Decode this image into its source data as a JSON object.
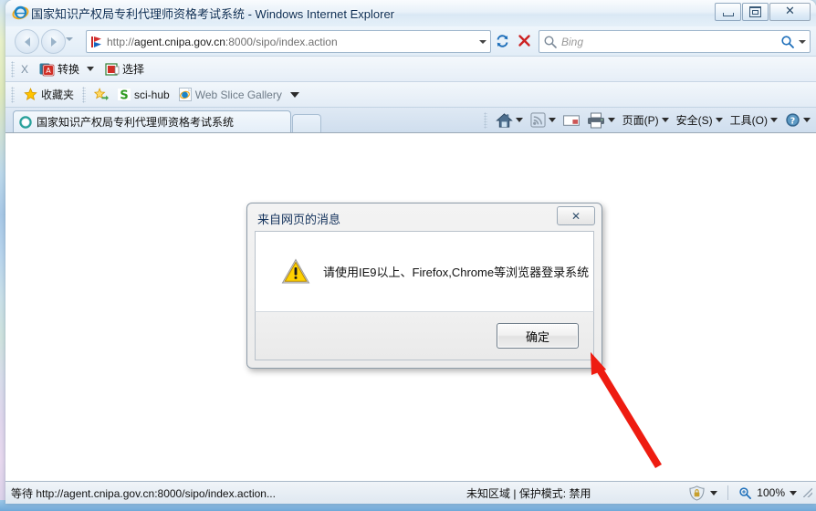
{
  "window": {
    "title": "国家知识产权局专利代理师资格考试系统 - Windows Internet Explorer",
    "minimize_label": "最小化",
    "maximize_label": "最大化",
    "close_label": "关闭"
  },
  "nav": {
    "back_label": "后退",
    "forward_label": "前进",
    "recent_pages_label": "最近访问的页面",
    "url_scheme": "http://",
    "url_domain": "agent.cnipa.gov.cn",
    "url_path": ":8000/sipo/index.action",
    "url_full": "http://agent.cnipa.gov.cn:8000/sipo/index.action",
    "refresh_label": "刷新",
    "stop_label": "停止",
    "search_placeholder": "Bing",
    "search_value": ""
  },
  "pdf_toolbar": {
    "close_label": "X",
    "convert_label": "转换",
    "select_label": "选择"
  },
  "favorites_bar": {
    "favorites_label": "收藏夹",
    "items": [
      {
        "label": "sci-hub"
      },
      {
        "label": "Web Slice Gallery"
      }
    ]
  },
  "tabs": {
    "active": "国家知识产权局专利代理师资格考试系统",
    "new_tab_label": "新选项卡"
  },
  "command_bar": {
    "home_label": "主页",
    "feeds_label": "源",
    "mail_label": "阅读邮件",
    "print_label": "打印",
    "page_label": "页面(P)",
    "safety_label": "安全(S)",
    "tools_label": "工具(O)",
    "help_label": "帮助"
  },
  "dialog": {
    "title": "来自网页的消息",
    "close_label": "关闭",
    "icon": "warning-triangle-icon",
    "message": "请使用IE9以上、Firefox,Chrome等浏览器登录系统",
    "ok_label": "确定"
  },
  "annotation": {
    "arrow_color": "#ee1c11"
  },
  "status_bar": {
    "left_text": "等待 http://agent.cnipa.gov.cn:8000/sipo/index.action...",
    "zone_text": "未知区域 | 保护模式: 禁用",
    "zoom_level": "100%"
  },
  "colors": {
    "accent": "#1e6fba",
    "warning": "#ffcc00",
    "arrow": "#ee1c11",
    "frame": "#dfe9f4"
  }
}
